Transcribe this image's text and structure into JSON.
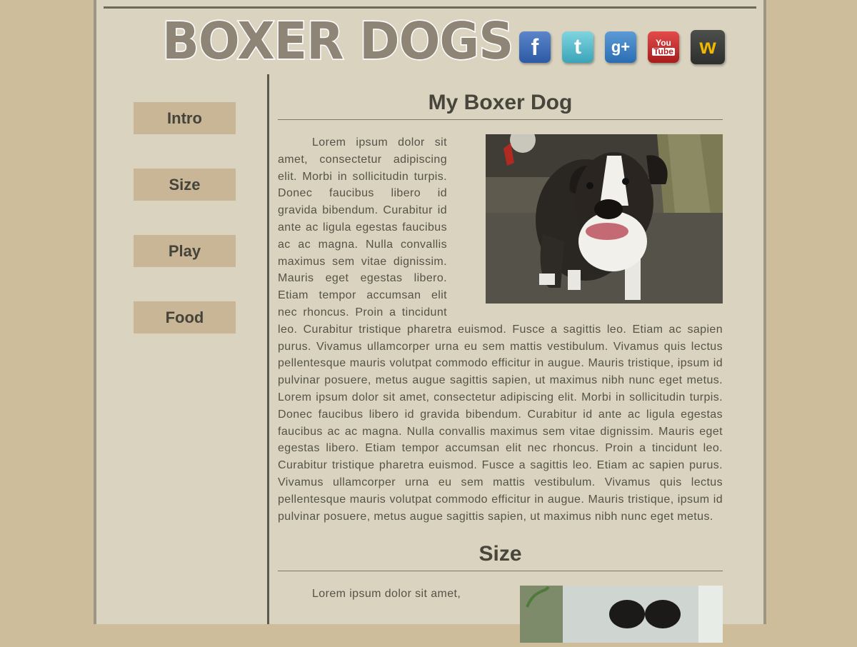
{
  "site": {
    "logo_text": "BOXER DOGS"
  },
  "social": [
    {
      "name": "facebook",
      "glyph": "f",
      "color": "#2c5aa4"
    },
    {
      "name": "twitter",
      "glyph": "t",
      "color": "#3ba4b8"
    },
    {
      "name": "google-plus",
      "glyph": "g+",
      "color": "#2a6db3"
    },
    {
      "name": "youtube",
      "glyph_top": "You",
      "glyph_bottom": "Tube",
      "color": "#a81c1c"
    },
    {
      "name": "wattpad",
      "glyph": "w",
      "color": "#2d2f2c"
    }
  ],
  "nav": {
    "items": [
      {
        "label": "Intro"
      },
      {
        "label": "Size"
      },
      {
        "label": "Play"
      },
      {
        "label": "Food"
      }
    ]
  },
  "main": {
    "title": "My Boxer Dog",
    "intro_text": "Lorem ipsum dolor sit amet, consectetur adipiscing elit. Morbi in sollicitudin turpis. Donec faucibus libero id gravida bibendum. Curabitur id ante ac ligula egestas faucibus ac ac magna. Nulla convallis maximus sem vitae dignissim. Mauris eget egestas libero. Etiam tempor accumsan elit nec rhoncus. Proin a tincidunt leo. Curabitur tristique pharetra euismod. Fusce a sagittis leo. Etiam ac sapien purus. Vivamus ullamcorper urna eu sem mattis vestibulum. Vivamus quis lectus pellentesque mauris volutpat commodo efficitur in augue. Mauris tristique, ipsum id pulvinar posuere, metus augue sagittis sapien, ut maximus nibh nunc eget metus. Lorem ipsum dolor sit amet, consectetur adipiscing elit. Morbi in sollicitudin turpis. Donec faucibus libero id gravida bibendum. Curabitur id ante ac ligula egestas faucibus ac ac magna. Nulla convallis maximus sem vitae dignissim. Mauris eget egestas libero. Etiam tempor accumsan elit nec rhoncus. Proin a tincidunt leo. Curabitur tristique pharetra euismod. Fusce a sagittis leo. Etiam ac sapien purus. Vivamus ullamcorper urna eu sem mattis vestibulum. Vivamus quis lectus pellentesque mauris volutpat commodo efficitur in augue. Mauris tristique, ipsum id pulvinar posuere, metus augue sagittis sapien, ut maximus nibh nunc eget metus.",
    "size_title": "Size",
    "size_text": "Lorem ipsum dolor sit amet,"
  }
}
